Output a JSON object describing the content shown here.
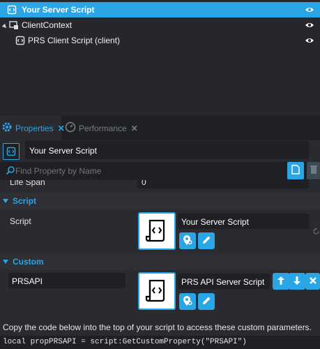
{
  "hierarchy": {
    "items": [
      {
        "label": "Your Server Script",
        "icon": "script-icon",
        "selected": true
      },
      {
        "label": "ClientContext",
        "icon": "client-context-icon",
        "selected": false
      },
      {
        "label": "PRS Client Script (client)",
        "icon": "script-icon",
        "selected": false
      }
    ]
  },
  "tabs": [
    {
      "label": "Properties",
      "icon": "gear-icon",
      "active": true
    },
    {
      "label": "Performance",
      "icon": "gauge-icon",
      "active": false
    }
  ],
  "object": {
    "name": "Your Server Script"
  },
  "search": {
    "placeholder": "Find Property by Name"
  },
  "partial_row": {
    "label": "Life Span",
    "value": "0"
  },
  "script_section": {
    "title": "Script",
    "label": "Script",
    "value": "Your Server Script"
  },
  "custom_section": {
    "title": "Custom",
    "label": "PRSAPI",
    "value": "PRS API Server Script"
  },
  "help_text": "Copy the code below into the top of your script to access these custom parameters.",
  "code_line": "local propPRSAPI = script:GetCustomProperty(\"PRSAPI\")",
  "colors": {
    "accent": "#2aa6e6",
    "background": "#2a2b30",
    "field": "#1f2024"
  }
}
